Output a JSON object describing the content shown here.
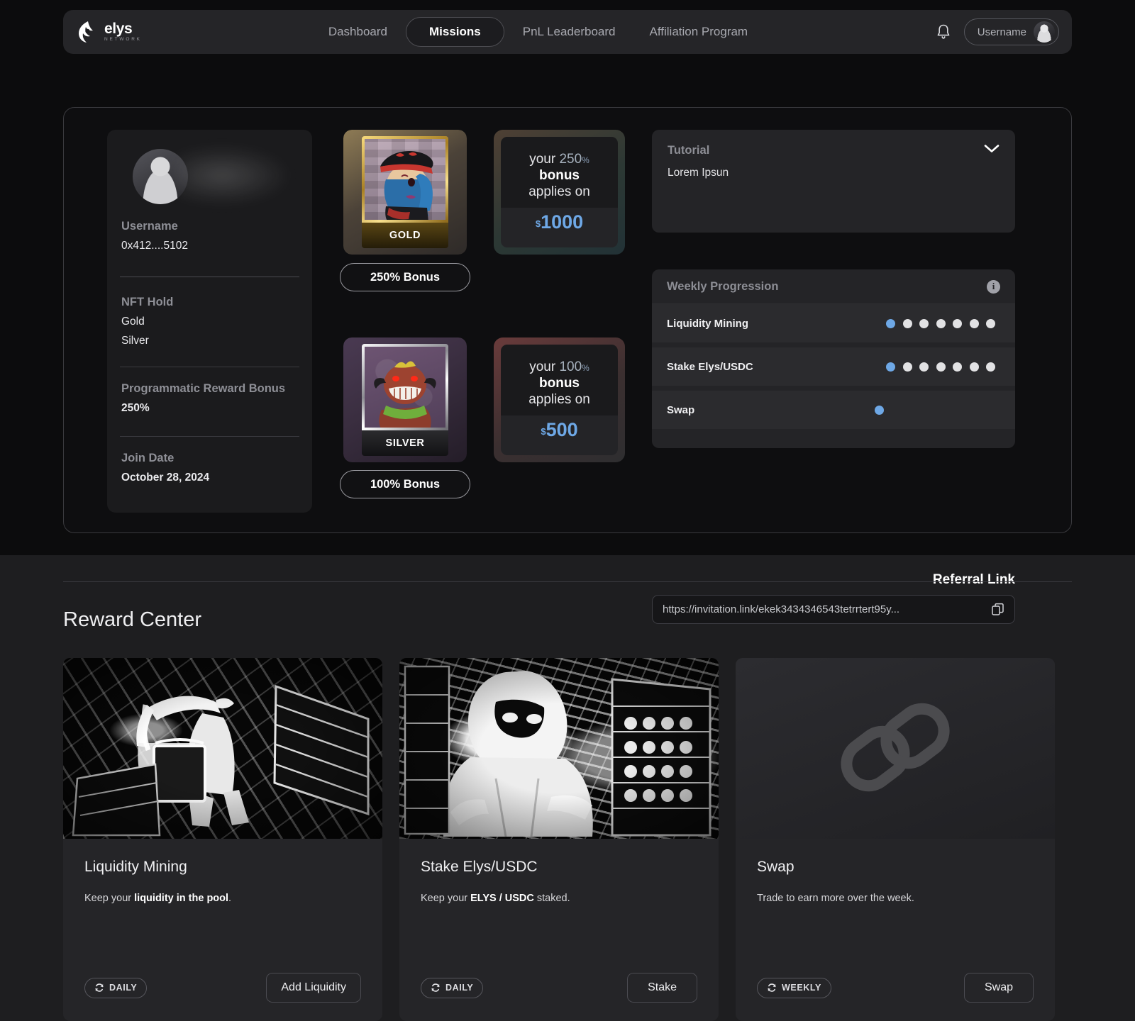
{
  "brand": {
    "name": "elys",
    "sub": "NETWORK"
  },
  "nav": {
    "items": [
      {
        "label": "Dashboard",
        "active": false
      },
      {
        "label": "Missions",
        "active": true
      },
      {
        "label": "PnL Leaderboard",
        "active": false
      },
      {
        "label": "Affiliation Program",
        "active": false
      }
    ],
    "bell_icon": "bell-icon",
    "user_label": "Username"
  },
  "profile": {
    "username_label": "Username",
    "address": "0x412....5102",
    "nft_hold_label": "NFT Hold",
    "nft_hold": [
      "Gold",
      "Silver"
    ],
    "reward_bonus_label": "Programmatic Reward Bonus",
    "reward_bonus_value": "250%",
    "join_date_label": "Join Date",
    "join_date_value": "October 28, 2024"
  },
  "nfts": [
    {
      "tier": "GOLD",
      "bonus_button": "250% Bonus"
    },
    {
      "tier": "SILVER",
      "bonus_button": "100% Bonus"
    }
  ],
  "bonus_boxes": [
    {
      "line1_prefix": "your ",
      "percent": "250",
      "percent_sign": "%",
      "line2": "bonus",
      "line3": "applies on",
      "currency": "$",
      "amount": "1000"
    },
    {
      "line1_prefix": "your ",
      "percent": "100",
      "percent_sign": "%",
      "line2": "bonus",
      "line3": "applies on",
      "currency": "$",
      "amount": "500"
    }
  ],
  "tutorial": {
    "title": "Tutorial",
    "body": "Lorem Ipsun",
    "toggle_icon": "chevron-down-icon"
  },
  "weekly_progression": {
    "title": "Weekly Progression",
    "info_icon": "info-icon",
    "rows": [
      {
        "name": "Liquidity Mining",
        "total": 7,
        "completed": 1
      },
      {
        "name": "Stake Elys/USDC",
        "total": 7,
        "completed": 1
      },
      {
        "name": "Swap",
        "total": 1,
        "completed": 1
      }
    ]
  },
  "referral": {
    "title": "Referral Link",
    "url": "https://invitation.link/ekek3434346543tetrrtert95y...",
    "copy_icon": "copy-icon"
  },
  "reward_center": {
    "title": "Reward Center",
    "cards": [
      {
        "name": "Liquidity Mining",
        "desc_prefix": "Keep your ",
        "desc_bold": "liquidity in the pool",
        "desc_suffix": ".",
        "frequency": "DAILY",
        "frequency_icon": "refresh-icon",
        "action": "Add Liquidity",
        "art": "comic-bucket-worker"
      },
      {
        "name": "Stake Elys/USDC",
        "desc_prefix": "Keep your ",
        "desc_bold": "ELYS / USDC",
        "desc_suffix": " staked.",
        "frequency": "DAILY",
        "frequency_icon": "refresh-icon",
        "action": "Stake",
        "art": "comic-hooded-worker"
      },
      {
        "name": "Swap",
        "desc_prefix": "Trade to earn more over the week.",
        "desc_bold": "",
        "desc_suffix": "",
        "frequency": "WEEKLY",
        "frequency_icon": "refresh-icon",
        "action": "Swap",
        "art": "chain-link-icon"
      }
    ]
  },
  "colors": {
    "accent_blue": "#6ea8e6",
    "panel_bg": "#252528",
    "page_bg": "#0c0c0d"
  }
}
